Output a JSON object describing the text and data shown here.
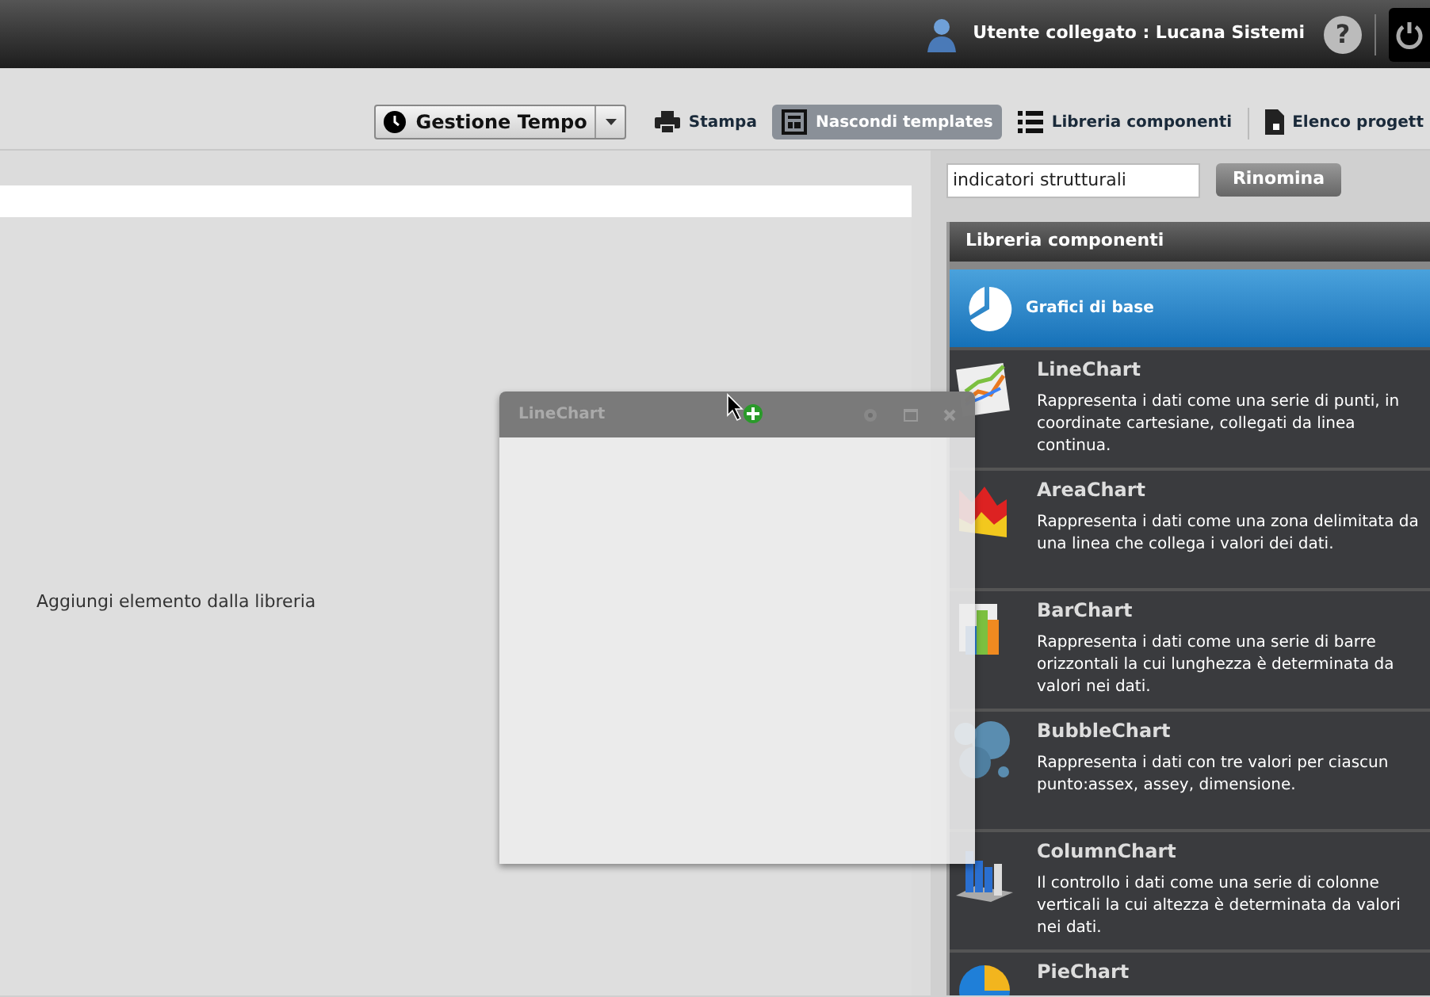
{
  "header": {
    "user_label": "Utente collegato : Lucana Sistemi",
    "help_glyph": "?"
  },
  "toolbar": [
    {
      "kind": "dropdown",
      "label": "Gestione Tempo"
    },
    {
      "kind": "print",
      "label": "Stampa",
      "selected": false
    },
    {
      "kind": "template",
      "label": "Nascondi templates",
      "selected": true
    },
    {
      "kind": "list",
      "label": "Libreria componenti",
      "selected": false
    },
    {
      "kind": "doc",
      "label": "Elenco progett",
      "selected": false
    }
  ],
  "canvas": {
    "hint": "Aggiungi elemento dalla libreria"
  },
  "rename": {
    "value": "indicatori strutturali",
    "button": "Rinomina"
  },
  "library": {
    "title": "Libreria componenti",
    "category": {
      "label": "Grafici di base",
      "selected": true
    },
    "items": [
      {
        "kind": "line",
        "name": "LineChart",
        "description": "Rappresenta i dati come una serie di punti, in coordinate cartesiane, collegati da linea continua."
      },
      {
        "kind": "area",
        "name": "AreaChart",
        "description": "Rappresenta i dati come una zona delimitata da una linea che collega i valori dei dati."
      },
      {
        "kind": "bar",
        "name": "BarChart",
        "description": "Rappresenta i dati come una serie di barre orizzontali la cui lunghezza è determinata da valori nei dati."
      },
      {
        "kind": "bubble",
        "name": "BubbleChart",
        "description": "Rappresenta i dati con tre valori per ciascun punto:assex, assey, dimensione."
      },
      {
        "kind": "column",
        "name": "ColumnChart",
        "description": "Il controllo i dati come una serie di colonne verticali la cui altezza è determinata da valori nei dati."
      },
      {
        "kind": "pie",
        "name": "PieChart"
      }
    ]
  },
  "drag_window": {
    "title": "LineChart"
  }
}
